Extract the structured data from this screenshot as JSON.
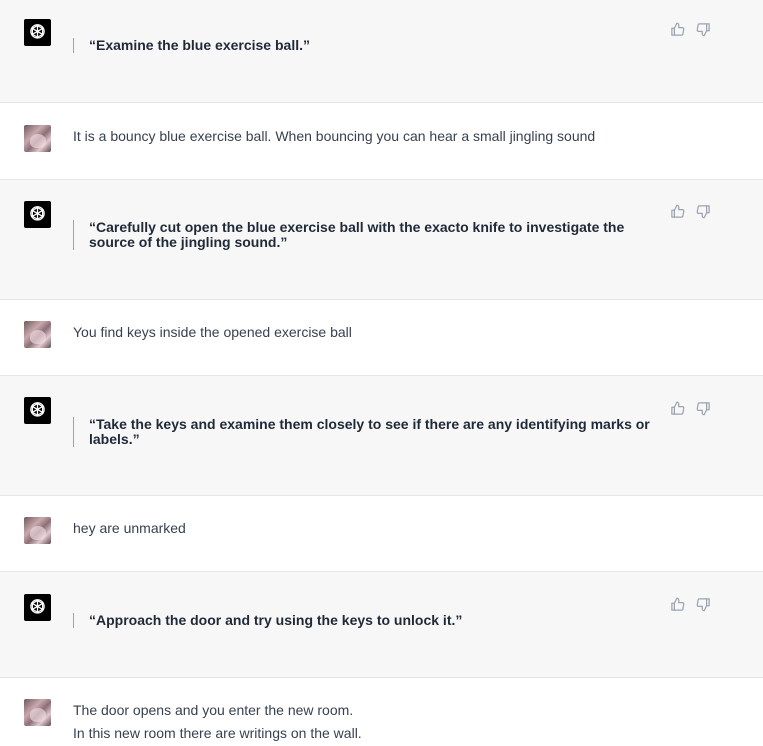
{
  "messages": [
    {
      "role": "assistant",
      "text": "“Examine the blue exercise ball.”"
    },
    {
      "role": "user",
      "text": "It is a bouncy blue exercise ball. When bouncing you can hear a small jingling sound"
    },
    {
      "role": "assistant",
      "text": "“Carefully cut open the blue exercise ball with the exacto knife to investigate the source of the jingling sound.”"
    },
    {
      "role": "user",
      "text": "You find keys inside the opened exercise ball"
    },
    {
      "role": "assistant",
      "text": "“Take the keys and examine them closely to see if there are any identifying marks or labels.”"
    },
    {
      "role": "user",
      "text": "hey are unmarked"
    },
    {
      "role": "assistant",
      "text": "“Approach the door and try using the keys to unlock it.”"
    },
    {
      "role": "user",
      "lines": [
        "The door opens and you enter the new room.",
        "In this new room there are writings on the wall."
      ]
    }
  ],
  "icons": {
    "assistant_avatar": "openai-logo-icon",
    "user_avatar": "user-photo",
    "thumbs_up": "thumbs-up-icon",
    "thumbs_down": "thumbs-down-icon"
  }
}
